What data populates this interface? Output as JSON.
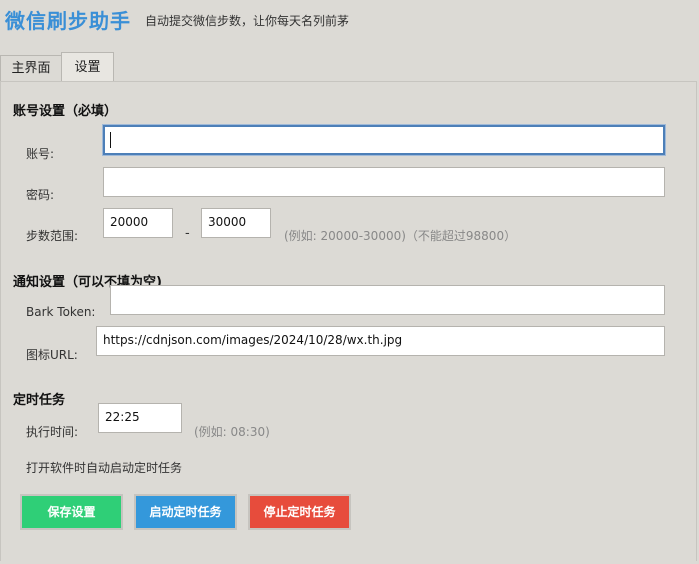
{
  "header": {
    "title": "微信刷步助手",
    "subtitle": "自动提交微信步数，让你每天名列前茅"
  },
  "tabs": [
    {
      "label": "主界面",
      "active": false
    },
    {
      "label": "设置",
      "active": true
    }
  ],
  "account": {
    "section_title": "账号设置（必填）",
    "account_label": "账号:",
    "account_value": "",
    "password_label": "密码:",
    "password_value": "",
    "steps_label": "步数范围:",
    "steps_min": "20000",
    "steps_dash": "-",
    "steps_max": "30000",
    "steps_hint": "(例如: 20000-30000)（不能超过98800）"
  },
  "notify": {
    "section_title": "通知设置（可以不填为空)",
    "bark_label": "Bark Token:",
    "bark_value": "",
    "icon_label": "图标URL:",
    "icon_value": "https://cdnjson.com/images/2024/10/28/wx.th.jpg"
  },
  "schedule": {
    "section_title": "定时任务",
    "time_label": "执行时间:",
    "time_value": "22:25",
    "time_hint": "(例如: 08:30)",
    "auto_start_text": "打开软件时自动启动定时任务"
  },
  "buttons": {
    "save_label": "保存设置",
    "start_label": "启动定时任务",
    "stop_label": "停止定时任务"
  },
  "colors": {
    "title": "#3a8fd6",
    "save": "#2fcf77",
    "start": "#3498db",
    "stop": "#e74c3c"
  }
}
